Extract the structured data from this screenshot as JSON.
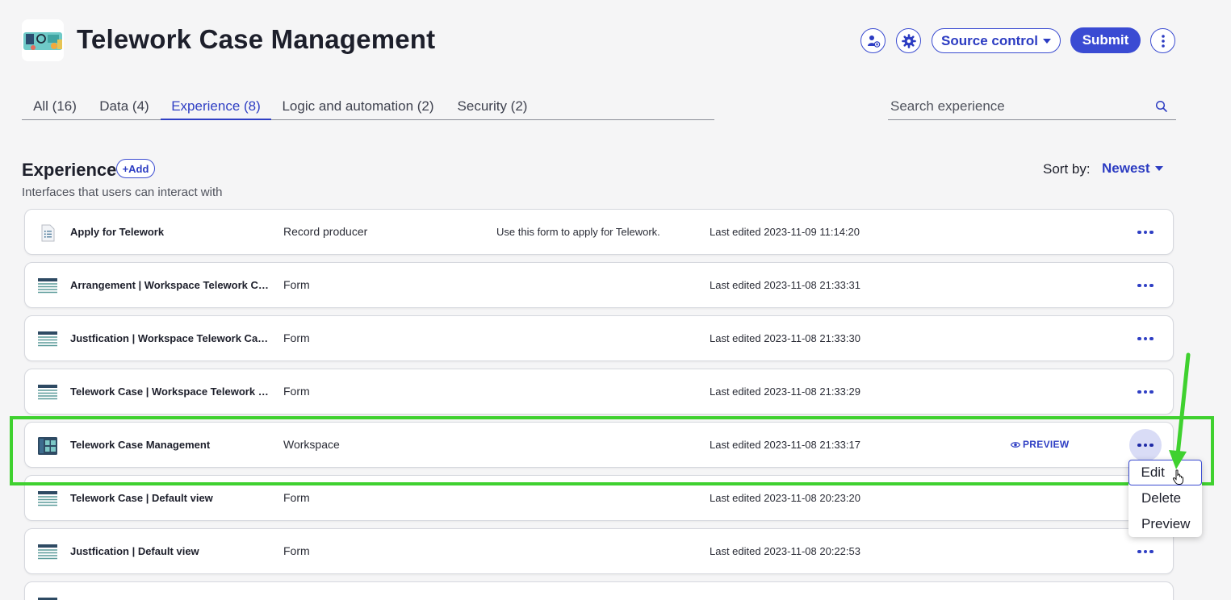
{
  "header": {
    "title": "Telework Case Management",
    "icon_buttons": [
      "collaborators-icon",
      "gear-icon"
    ],
    "source_control_label": "Source control",
    "submit_label": "Submit",
    "more_icon": "vertical-ellipsis-icon"
  },
  "tabs": [
    {
      "label": "All (16)",
      "active": false
    },
    {
      "label": "Data (4)",
      "active": false
    },
    {
      "label": "Experience (8)",
      "active": true
    },
    {
      "label": "Logic and automation (2)",
      "active": false
    },
    {
      "label": "Security (2)",
      "active": false
    }
  ],
  "search": {
    "placeholder": "Search experience",
    "value": ""
  },
  "section": {
    "title": "Experience",
    "add_label": "+Add",
    "subtitle": "Interfaces that users can interact with",
    "sort_label": "Sort by:",
    "sort_value": "Newest"
  },
  "rows": [
    {
      "name": "Apply for Telework",
      "type": "Record producer",
      "description": "Use this form to apply for Telework.",
      "edited": "Last edited 2023-11-09 11:14:20",
      "icon": "record-producer-icon"
    },
    {
      "name": "Arrangement | Workspace Telework Case Management",
      "type": "Form",
      "description": "",
      "edited": "Last edited 2023-11-08 21:33:31",
      "icon": "form-icon"
    },
    {
      "name": "Justfication | Workspace Telework Case Management",
      "type": "Form",
      "description": "",
      "edited": "Last edited 2023-11-08 21:33:30",
      "icon": "form-icon"
    },
    {
      "name": "Telework Case | Workspace Telework Case Management",
      "type": "Form",
      "description": "",
      "edited": "Last edited 2023-11-08 21:33:29",
      "icon": "form-icon"
    },
    {
      "name": "Telework Case Management",
      "type": "Workspace",
      "description": "",
      "edited": "Last edited 2023-11-08 21:33:17",
      "icon": "workspace-icon",
      "preview_label": "PREVIEW"
    },
    {
      "name": "Telework Case | Default view",
      "type": "Form",
      "description": "",
      "edited": "Last edited 2023-11-08 20:23:20",
      "icon": "form-icon"
    },
    {
      "name": "Justfication | Default view",
      "type": "Form",
      "description": "",
      "edited": "Last edited 2023-11-08 20:22:53",
      "icon": "form-icon"
    }
  ],
  "context_menu": {
    "items": [
      "Edit",
      "Delete",
      "Preview"
    ],
    "focused": "Edit"
  },
  "colors": {
    "accent": "#3a4bd3",
    "annotation": "#3fd12f",
    "background": "#f5f5f6"
  }
}
